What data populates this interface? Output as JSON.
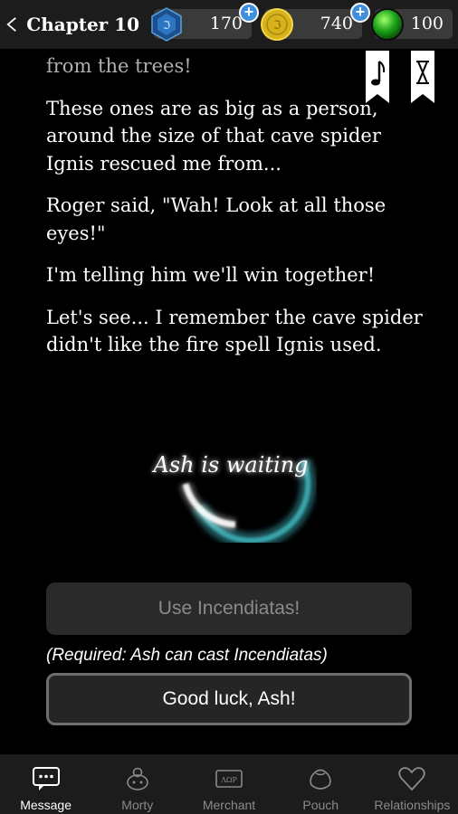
{
  "header": {
    "chapter_title": "Chapter 10",
    "currencies": [
      {
        "icon": "gem-icon",
        "value": "170"
      },
      {
        "icon": "coin-icon",
        "value": "740"
      },
      {
        "icon": "orb-icon",
        "value": "100"
      }
    ]
  },
  "story": {
    "paragraphs": [
      "from the trees!",
      "These ones are as big as a person, around the size of that cave spider Ignis rescued me from...",
      "Roger said, \"Wah! Look at all those eyes!\"",
      "I'm telling him we'll win together!",
      "Let's see... I remember the cave spider didn't like the fire spell Ignis used."
    ]
  },
  "waiting": {
    "text": "Ash is waiting"
  },
  "choices": {
    "disabled_label": "Use Incendiatas!",
    "requirement": "(Required: Ash can cast Incendiatas)",
    "active_label": "Good luck, Ash!"
  },
  "nav": {
    "items": [
      {
        "label": "Message",
        "icon": "message-icon"
      },
      {
        "label": "Morty",
        "icon": "pet-icon"
      },
      {
        "label": "Merchant",
        "icon": "merchant-icon"
      },
      {
        "label": "Pouch",
        "icon": "pouch-icon"
      },
      {
        "label": "Relationships",
        "icon": "heart-icon"
      }
    ],
    "active_index": 0
  },
  "colors": {
    "bar_bg": "#1c1c1c",
    "plus_blue": "#3e8fe0",
    "glow_teal": "#3fb8c0"
  }
}
